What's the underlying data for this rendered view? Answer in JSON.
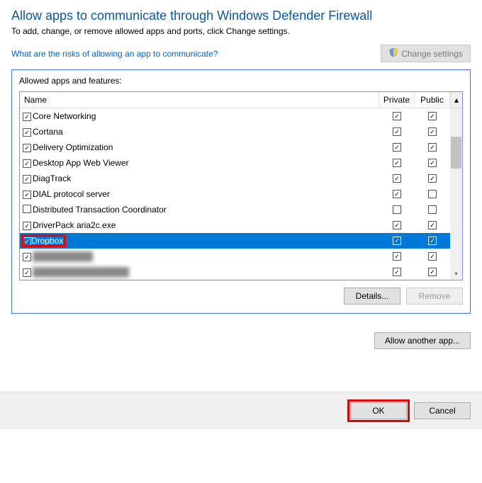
{
  "title": "Allow apps to communicate through Windows Defender Firewall",
  "subtitle": "To add, change, or remove allowed apps and ports, click Change settings.",
  "help_link": "What are the risks of allowing an app to communicate?",
  "change_settings_label": "Change settings",
  "group_label": "Allowed apps and features:",
  "columns": {
    "name": "Name",
    "private": "Private",
    "public": "Public"
  },
  "rows": [
    {
      "enabled": true,
      "name": "Core Networking",
      "private": true,
      "public": true,
      "selected": false,
      "highlight": false,
      "blurred": false
    },
    {
      "enabled": true,
      "name": "Cortana",
      "private": true,
      "public": true,
      "selected": false,
      "highlight": false,
      "blurred": false
    },
    {
      "enabled": true,
      "name": "Delivery Optimization",
      "private": true,
      "public": true,
      "selected": false,
      "highlight": false,
      "blurred": false
    },
    {
      "enabled": true,
      "name": "Desktop App Web Viewer",
      "private": true,
      "public": true,
      "selected": false,
      "highlight": false,
      "blurred": false
    },
    {
      "enabled": true,
      "name": "DiagTrack",
      "private": true,
      "public": true,
      "selected": false,
      "highlight": false,
      "blurred": false
    },
    {
      "enabled": true,
      "name": "DIAL protocol server",
      "private": true,
      "public": false,
      "selected": false,
      "highlight": false,
      "blurred": false
    },
    {
      "enabled": false,
      "name": "Distributed Transaction Coordinator",
      "private": false,
      "public": false,
      "selected": false,
      "highlight": false,
      "blurred": false
    },
    {
      "enabled": true,
      "name": "DriverPack aria2c.exe",
      "private": true,
      "public": true,
      "selected": false,
      "highlight": false,
      "blurred": false
    },
    {
      "enabled": true,
      "name": "Dropbox",
      "private": true,
      "public": true,
      "selected": true,
      "highlight": true,
      "blurred": false
    },
    {
      "enabled": true,
      "name": "██████████",
      "private": true,
      "public": true,
      "selected": false,
      "highlight": false,
      "blurred": true
    },
    {
      "enabled": true,
      "name": "████████████████",
      "private": true,
      "public": true,
      "selected": false,
      "highlight": false,
      "blurred": true
    }
  ],
  "buttons": {
    "details": "Details...",
    "remove": "Remove",
    "allow_another": "Allow another app...",
    "ok": "OK",
    "cancel": "Cancel"
  }
}
